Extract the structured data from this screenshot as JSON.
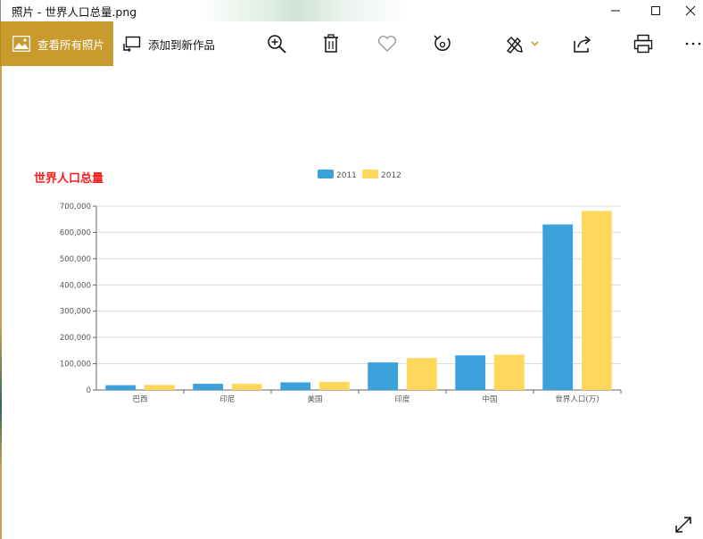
{
  "window": {
    "title": "照片 - 世界人口总量.png",
    "controls": {
      "minimize_icon": "minimize-icon",
      "maximize_icon": "maximize-icon",
      "close_icon": "close-icon"
    }
  },
  "toolbar": {
    "view_all_label": "查看所有照片",
    "add_to_creation_label": "添加到新作品",
    "icons": [
      "zoom-in-icon",
      "delete-icon",
      "favorite-icon",
      "rotate-icon",
      "edit-draw-icon",
      "share-icon",
      "print-icon",
      "more-icon"
    ],
    "accent_color": "#c99a2e"
  },
  "chart_data": {
    "type": "bar",
    "title": "世界人口总量",
    "categories": [
      "巴西",
      "印尼",
      "美国",
      "印度",
      "中国",
      "世界人口(万)"
    ],
    "series": [
      {
        "name": "2011",
        "color": "#3aa1db",
        "values": [
          18203,
          23489,
          29034,
          104970,
          131744,
          630230
        ]
      },
      {
        "name": "2012",
        "color": "#ffd75a",
        "values": [
          19325,
          23438,
          31000,
          121594,
          134141,
          681807
        ]
      }
    ],
    "ylim": [
      0,
      700000
    ],
    "yticks": [
      "0",
      "100,000",
      "200,000",
      "300,000",
      "400,000",
      "500,000",
      "600,000",
      "700,000"
    ],
    "grid": true,
    "legend_position": "top-center"
  }
}
